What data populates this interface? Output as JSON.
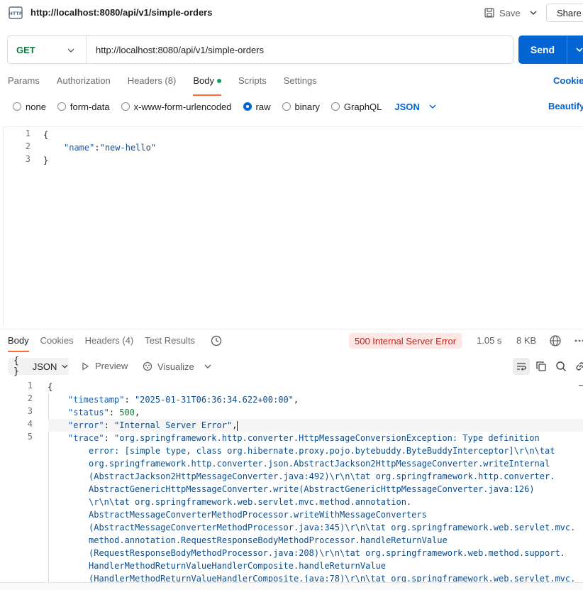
{
  "header": {
    "title": "http://localhost:8080/api/v1/simple-orders",
    "save_label": "Save",
    "share_label": "Share"
  },
  "request": {
    "method": "GET",
    "url": "http://localhost:8080/api/v1/simple-orders",
    "send_label": "Send"
  },
  "request_tabs": {
    "params": "Params",
    "authorization": "Authorization",
    "headers": "Headers (8)",
    "body": "Body",
    "scripts": "Scripts",
    "settings": "Settings",
    "cookies": "Cookies"
  },
  "body_types": {
    "none": "none",
    "form_data": "form-data",
    "urlencoded": "x-www-form-urlencoded",
    "raw": "raw",
    "binary": "binary",
    "graphql": "GraphQL",
    "language": "JSON",
    "beautify": "Beautify",
    "selected": "raw"
  },
  "request_body": {
    "line_numbers": [
      "1",
      "2",
      "3"
    ],
    "line1": "{",
    "key": "\"name\"",
    "colon": ":",
    "value": "\"new-hello\"",
    "line3": "}"
  },
  "response_tabs": {
    "body": "Body",
    "cookies": "Cookies",
    "headers": "Headers (4)",
    "test_results": "Test Results",
    "status": "500 Internal Server Error",
    "time": "1.05 s",
    "size": "8 KB"
  },
  "response_toolbar": {
    "format_braces": "{ }",
    "format": "JSON",
    "preview": "Preview",
    "visualize": "Visualize"
  },
  "response_body": {
    "line_numbers": [
      "1",
      "2",
      "3",
      "4",
      "5"
    ],
    "open": "{",
    "timestamp_key": "\"timestamp\"",
    "timestamp_val": "\"2025-01-31T06:36:34.622+00:00\"",
    "status_key": "\"status\"",
    "status_val": "500",
    "error_key": "\"error\"",
    "error_val": "\"Internal Server Error\"",
    "trace_key": "\"trace\"",
    "trace_lines": [
      "\"org.springframework.http.converter.HttpMessageConversionException: Type definition",
      "error: [simple type, class org.hibernate.proxy.pojo.bytebuddy.ByteBuddyInterceptor]\\r\\n\\tat",
      "org.springframework.http.converter.json.AbstractJackson2HttpMessageConverter.writeInternal",
      "(AbstractJackson2HttpMessageConverter.java:492)\\r\\n\\tat org.springframework.http.converter.",
      "AbstractGenericHttpMessageConverter.write(AbstractGenericHttpMessageConverter.java:126)",
      "\\r\\n\\tat org.springframework.web.servlet.mvc.method.annotation.",
      "AbstractMessageConverterMethodProcessor.writeWithMessageConverters",
      "(AbstractMessageConverterMethodProcessor.java:345)\\r\\n\\tat org.springframework.web.servlet.mvc.",
      "method.annotation.RequestResponseBodyMethodProcessor.handleReturnValue",
      "(RequestResponseBodyMethodProcessor.java:208)\\r\\n\\tat org.springframework.web.method.support.",
      "HandlerMethodReturnValueHandlerComposite.handleReturnValue",
      "(HandlerMethodReturnValueHandlerComposite.java:78)\\r\\n\\tat org.springframework.web.servlet.mvc."
    ]
  },
  "colors": {
    "send": "#0265d2",
    "method_get": "#0f7b3f",
    "tab_indicator": "#ff6c37",
    "error_badge_bg": "#fde8e6",
    "error_badge_text": "#b3261e"
  }
}
